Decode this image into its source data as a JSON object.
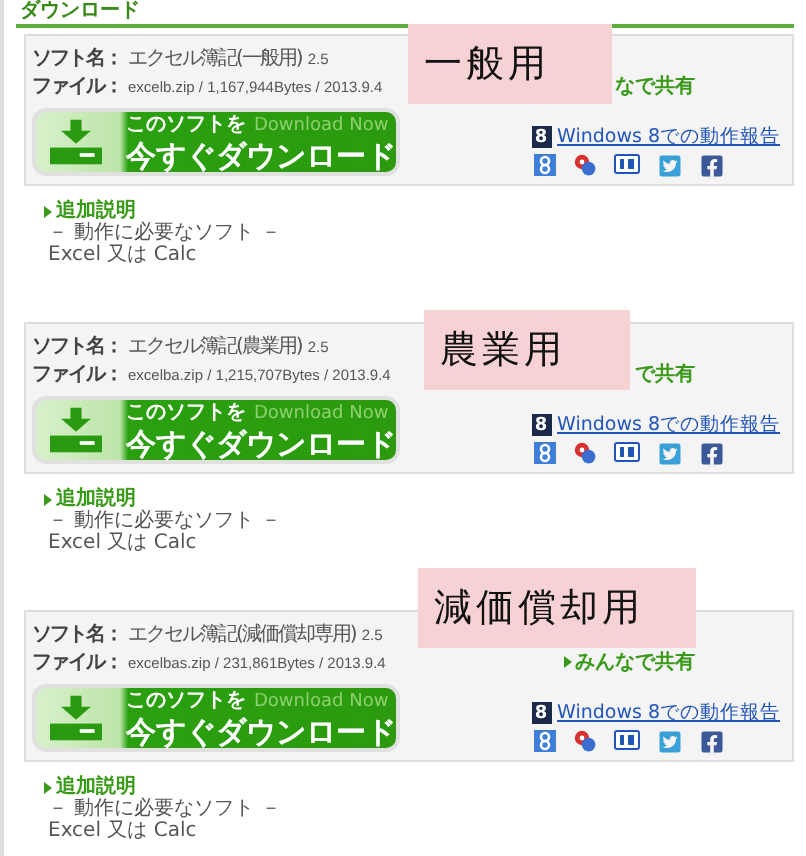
{
  "header": {
    "title": "ダウンロード"
  },
  "sections": [
    {
      "tag": "一般用",
      "name_label": "ソフト名：",
      "name": "エクセル簿記(一般用)",
      "version": "2.5",
      "file_label": "ファイル：",
      "file": "excelb.zip / 1,167,944Bytes / 2013.9.4",
      "download": {
        "line1": "このソフトを",
        "line1_en": "Download Now",
        "line2": "今すぐダウンロード"
      },
      "share": {
        "text": "なで共有",
        "bullet": false
      },
      "report": {
        "badge": "8",
        "link": "Windows 8での動作報告"
      },
      "notes": {
        "heading": "追加説明",
        "lines": [
          "－ 動作に必要なソフト －",
          "Excel 又は Calc"
        ]
      }
    },
    {
      "tag": "農業用",
      "name_label": "ソフト名：",
      "name": "エクセル簿記(農業用)",
      "version": "2.5",
      "file_label": "ファイル：",
      "file": "excelba.zip / 1,215,707Bytes / 2013.9.4",
      "download": {
        "line1": "このソフトを",
        "line1_en": "Download Now",
        "line2": "今すぐダウンロード"
      },
      "share": {
        "text": "で共有",
        "bullet": false
      },
      "report": {
        "badge": "8",
        "link": "Windows 8での動作報告"
      },
      "notes": {
        "heading": "追加説明",
        "lines": [
          "－ 動作に必要なソフト －",
          "Excel 又は Calc"
        ]
      }
    },
    {
      "tag": "減価償却用",
      "name_label": "ソフト名：",
      "name": "エクセル簿記(減価償却専用)",
      "version": "2.5",
      "file_label": "ファイル：",
      "file": "excelbas.zip / 231,861Bytes / 2013.9.4",
      "download": {
        "line1": "このソフトを",
        "line1_en": "Download Now",
        "line2": "今すぐダウンロード"
      },
      "share": {
        "text": "みんなで共有",
        "bullet": true
      },
      "report": {
        "badge": "8",
        "link": "Windows 8での動作報告"
      },
      "notes": {
        "heading": "追加説明",
        "lines": [
          "－ 動作に必要なソフト －",
          "Excel 又は Calc"
        ]
      }
    }
  ]
}
